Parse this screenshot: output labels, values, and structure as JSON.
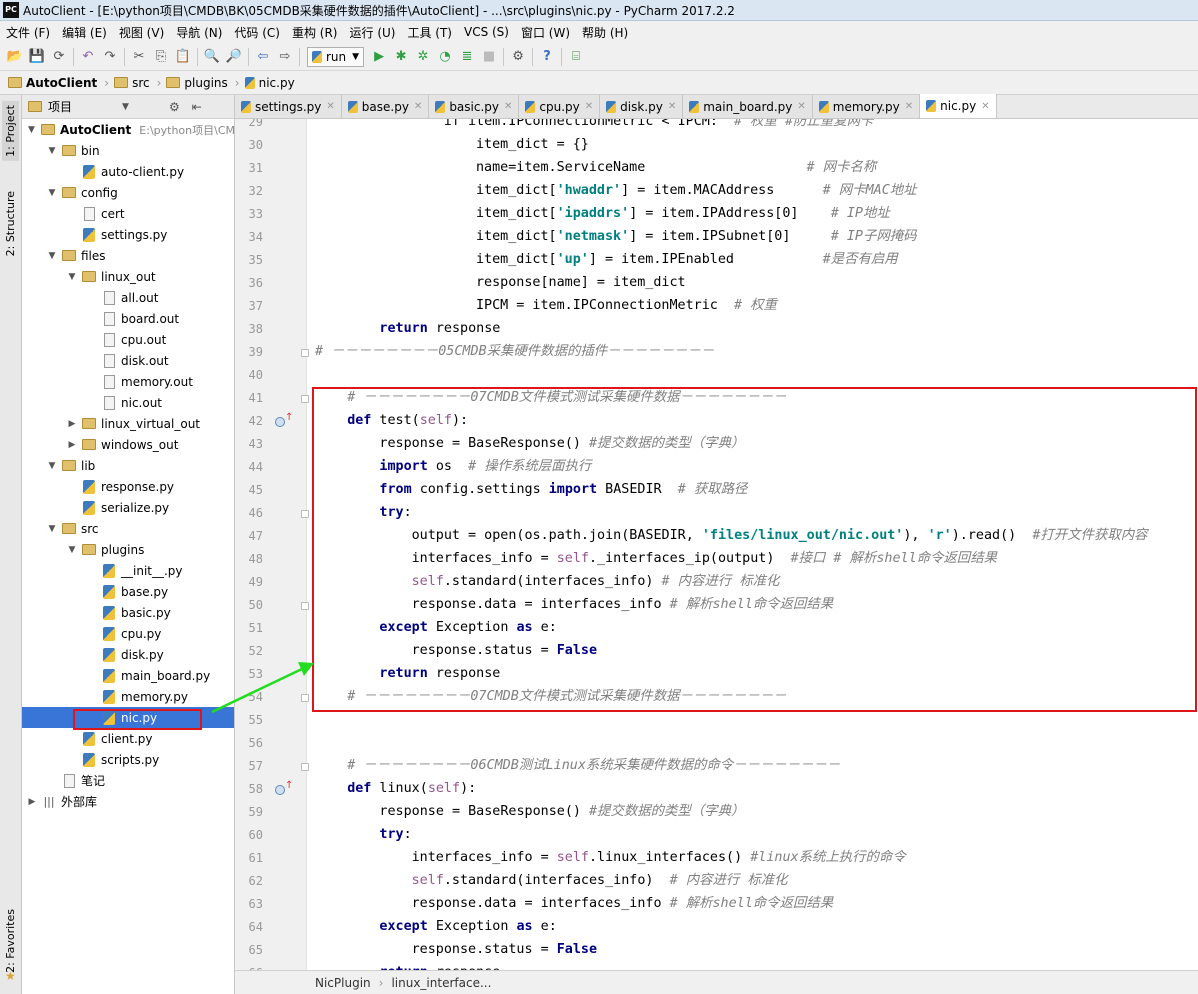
{
  "window": {
    "title": "AutoClient - [E:\\python项目\\CMDB\\BK\\05CMDB采集硬件数据的插件\\AutoClient] - ...\\src\\plugins\\nic.py - PyCharm 2017.2.2",
    "app_icon": "PC"
  },
  "menu": [
    "文件 (F)",
    "编辑 (E)",
    "视图 (V)",
    "导航 (N)",
    "代码 (C)",
    "重构 (R)",
    "运行 (U)",
    "工具 (T)",
    "VCS (S)",
    "窗口 (W)",
    "帮助 (H)"
  ],
  "toolbar": {
    "run_config": "run"
  },
  "breadcrumb": [
    "AutoClient",
    "src",
    "plugins",
    "nic.py"
  ],
  "left_tabs": {
    "project": "1: Project",
    "structure": "2: Structure",
    "favorites": "2: Favorites"
  },
  "project": {
    "header": "项目",
    "tree": [
      {
        "label": "AutoClient",
        "hint": "E:\\python项目\\CM",
        "type": "folder",
        "depth": 0,
        "expanded": true,
        "bold": true
      },
      {
        "label": "bin",
        "type": "folder",
        "depth": 1,
        "expanded": true
      },
      {
        "label": "auto-client.py",
        "type": "py",
        "depth": 2
      },
      {
        "label": "config",
        "type": "folder",
        "depth": 1,
        "expanded": true
      },
      {
        "label": "cert",
        "type": "file",
        "depth": 2
      },
      {
        "label": "settings.py",
        "type": "py",
        "depth": 2
      },
      {
        "label": "files",
        "type": "folder",
        "depth": 1,
        "expanded": true
      },
      {
        "label": "linux_out",
        "type": "folder",
        "depth": 2,
        "expanded": true
      },
      {
        "label": "all.out",
        "type": "file",
        "depth": 3
      },
      {
        "label": "board.out",
        "type": "file",
        "depth": 3
      },
      {
        "label": "cpu.out",
        "type": "file",
        "depth": 3
      },
      {
        "label": "disk.out",
        "type": "file",
        "depth": 3
      },
      {
        "label": "memory.out",
        "type": "file",
        "depth": 3
      },
      {
        "label": "nic.out",
        "type": "file",
        "depth": 3
      },
      {
        "label": "linux_virtual_out",
        "type": "folder",
        "depth": 2,
        "expanded": false
      },
      {
        "label": "windows_out",
        "type": "folder",
        "depth": 2,
        "expanded": false
      },
      {
        "label": "lib",
        "type": "folder",
        "depth": 1,
        "expanded": true
      },
      {
        "label": "response.py",
        "type": "py",
        "depth": 2
      },
      {
        "label": "serialize.py",
        "type": "py",
        "depth": 2
      },
      {
        "label": "src",
        "type": "folder",
        "depth": 1,
        "expanded": true
      },
      {
        "label": "plugins",
        "type": "folder",
        "depth": 2,
        "expanded": true
      },
      {
        "label": "__init__.py",
        "type": "py",
        "depth": 3
      },
      {
        "label": "base.py",
        "type": "py",
        "depth": 3
      },
      {
        "label": "basic.py",
        "type": "py",
        "depth": 3
      },
      {
        "label": "cpu.py",
        "type": "py",
        "depth": 3
      },
      {
        "label": "disk.py",
        "type": "py",
        "depth": 3
      },
      {
        "label": "main_board.py",
        "type": "py",
        "depth": 3
      },
      {
        "label": "memory.py",
        "type": "py",
        "depth": 3
      },
      {
        "label": "nic.py",
        "type": "py",
        "depth": 3,
        "selected": true
      },
      {
        "label": "client.py",
        "type": "py",
        "depth": 2
      },
      {
        "label": "scripts.py",
        "type": "py",
        "depth": 2
      },
      {
        "label": "笔记",
        "type": "file",
        "depth": 1
      },
      {
        "label": "外部库",
        "type": "lib",
        "depth": 0,
        "expanded": false
      }
    ]
  },
  "tabs": [
    {
      "label": "settings.py"
    },
    {
      "label": "base.py"
    },
    {
      "label": "basic.py"
    },
    {
      "label": "cpu.py"
    },
    {
      "label": "disk.py"
    },
    {
      "label": "main_board.py"
    },
    {
      "label": "memory.py"
    },
    {
      "label": "nic.py",
      "active": true
    }
  ],
  "code": [
    {
      "n": "29",
      "i": 16,
      "t": [
        [
          "if item.IPConnectionMetric < IPCM:  ",
          ""
        ],
        [
          "# 权重 #防止重复网卡",
          "c"
        ]
      ]
    },
    {
      "n": "30",
      "i": 20,
      "t": [
        [
          "item_dict = {}",
          ""
        ]
      ]
    },
    {
      "n": "31",
      "i": 20,
      "t": [
        [
          "name=item.ServiceName                    ",
          ""
        ],
        [
          "# 网卡名称",
          "c"
        ]
      ]
    },
    {
      "n": "32",
      "i": 20,
      "t": [
        [
          "item_dict[",
          ""
        ],
        [
          "'hwaddr'",
          "s"
        ],
        [
          "] = item.MACAddress      ",
          ""
        ],
        [
          "# 网卡MAC地址",
          "c"
        ]
      ]
    },
    {
      "n": "33",
      "i": 20,
      "t": [
        [
          "item_dict[",
          ""
        ],
        [
          "'ipaddrs'",
          "s"
        ],
        [
          "] = item.IPAddress[0]    ",
          ""
        ],
        [
          "# IP地址",
          "c"
        ]
      ]
    },
    {
      "n": "34",
      "i": 20,
      "t": [
        [
          "item_dict[",
          ""
        ],
        [
          "'netmask'",
          "s"
        ],
        [
          "] = item.IPSubnet[0]     ",
          ""
        ],
        [
          "# IP子网掩码",
          "c"
        ]
      ]
    },
    {
      "n": "35",
      "i": 20,
      "t": [
        [
          "item_dict[",
          ""
        ],
        [
          "'up'",
          "s"
        ],
        [
          "] = item.IPEnabled           ",
          ""
        ],
        [
          "#是否有启用",
          "c"
        ]
      ]
    },
    {
      "n": "36",
      "i": 20,
      "t": [
        [
          "response[name] = item_dict",
          ""
        ]
      ]
    },
    {
      "n": "37",
      "i": 20,
      "t": [
        [
          "IPCM = item.IPConnectionMetric  ",
          ""
        ],
        [
          "# 权重",
          "c"
        ]
      ]
    },
    {
      "n": "38",
      "i": 8,
      "t": [
        [
          "return",
          "k"
        ],
        [
          " response",
          ""
        ]
      ]
    },
    {
      "n": "39",
      "i": 0,
      "t": [
        [
          "# －－－－－－－－05CMDB采集硬件数据的插件－－－－－－－－",
          "c"
        ]
      ]
    },
    {
      "n": "40",
      "i": 0,
      "t": []
    },
    {
      "n": "41",
      "i": 4,
      "t": [
        [
          "# －－－－－－－－07CMDB文件模式测试采集硬件数据－－－－－－－－",
          "c"
        ]
      ]
    },
    {
      "n": "42",
      "i": 4,
      "t": [
        [
          "def",
          "k"
        ],
        [
          " test(",
          ""
        ],
        [
          "self",
          "sf"
        ],
        [
          "):",
          ""
        ]
      ]
    },
    {
      "n": "43",
      "i": 8,
      "t": [
        [
          "response = BaseResponse() ",
          ""
        ],
        [
          "#提交数据的类型（字典）",
          "c"
        ]
      ]
    },
    {
      "n": "44",
      "i": 8,
      "t": [
        [
          "import",
          "k"
        ],
        [
          " os  ",
          ""
        ],
        [
          "# 操作系统层面执行",
          "c"
        ]
      ]
    },
    {
      "n": "45",
      "i": 8,
      "t": [
        [
          "from",
          "k"
        ],
        [
          " config.settings ",
          ""
        ],
        [
          "import",
          "k"
        ],
        [
          " BASEDIR  ",
          ""
        ],
        [
          "# 获取路径",
          "c"
        ]
      ]
    },
    {
      "n": "46",
      "i": 8,
      "t": [
        [
          "try",
          "k"
        ],
        [
          ":",
          ""
        ]
      ]
    },
    {
      "n": "47",
      "i": 12,
      "t": [
        [
          "output = open(os.path.join(BASEDIR, ",
          ""
        ],
        [
          "'files/linux_out/nic.out'",
          "s"
        ],
        [
          "), ",
          ""
        ],
        [
          "'r'",
          "s"
        ],
        [
          ").read()  ",
          ""
        ],
        [
          "#打开文件获取内容",
          "c"
        ]
      ]
    },
    {
      "n": "48",
      "i": 12,
      "t": [
        [
          "interfaces_info = ",
          ""
        ],
        [
          "self",
          "sf"
        ],
        [
          "._interfaces_ip(output)  ",
          ""
        ],
        [
          "#接口 # 解析shell命令返回结果",
          "c"
        ]
      ]
    },
    {
      "n": "49",
      "i": 12,
      "t": [
        [
          "self",
          "sf"
        ],
        [
          ".standard(interfaces_info) ",
          ""
        ],
        [
          "# 内容进行 标准化",
          "c"
        ]
      ]
    },
    {
      "n": "50",
      "i": 12,
      "t": [
        [
          "response.data = interfaces_info ",
          ""
        ],
        [
          "# 解析shell命令返回结果",
          "c"
        ]
      ]
    },
    {
      "n": "51",
      "i": 8,
      "t": [
        [
          "except",
          "k"
        ],
        [
          " Exception ",
          ""
        ],
        [
          "as",
          "k"
        ],
        [
          " e:",
          ""
        ]
      ]
    },
    {
      "n": "52",
      "i": 12,
      "t": [
        [
          "response.status = ",
          ""
        ],
        [
          "False",
          "k"
        ]
      ]
    },
    {
      "n": "53",
      "i": 8,
      "t": [
        [
          "return",
          "k"
        ],
        [
          " response",
          ""
        ]
      ]
    },
    {
      "n": "54",
      "i": 4,
      "t": [
        [
          "# －－－－－－－－07CMDB文件模式测试采集硬件数据－－－－－－－－",
          "c"
        ]
      ]
    },
    {
      "n": "55",
      "i": 0,
      "t": []
    },
    {
      "n": "56",
      "i": 0,
      "t": []
    },
    {
      "n": "57",
      "i": 4,
      "t": [
        [
          "# －－－－－－－－06CMDB测试Linux系统采集硬件数据的命令－－－－－－－－",
          "c"
        ]
      ]
    },
    {
      "n": "58",
      "i": 4,
      "t": [
        [
          "def",
          "k"
        ],
        [
          " linux(",
          ""
        ],
        [
          "self",
          "sf"
        ],
        [
          "):",
          ""
        ]
      ]
    },
    {
      "n": "59",
      "i": 8,
      "t": [
        [
          "response = BaseResponse() ",
          ""
        ],
        [
          "#提交数据的类型（字典）",
          "c"
        ]
      ]
    },
    {
      "n": "60",
      "i": 8,
      "t": [
        [
          "try",
          "k"
        ],
        [
          ":",
          ""
        ]
      ]
    },
    {
      "n": "61",
      "i": 12,
      "t": [
        [
          "interfaces_info = ",
          ""
        ],
        [
          "self",
          "sf"
        ],
        [
          ".linux_interfaces() ",
          ""
        ],
        [
          "#linux系统上执行的命令",
          "c"
        ]
      ]
    },
    {
      "n": "62",
      "i": 12,
      "t": [
        [
          "self",
          "sf"
        ],
        [
          ".standard(interfaces_info)  ",
          ""
        ],
        [
          "# 内容进行 标准化",
          "c"
        ]
      ]
    },
    {
      "n": "63",
      "i": 12,
      "t": [
        [
          "response.data = interfaces_info ",
          ""
        ],
        [
          "# 解析shell命令返回结果",
          "c"
        ]
      ]
    },
    {
      "n": "64",
      "i": 8,
      "t": [
        [
          "except",
          "k"
        ],
        [
          " Exception ",
          ""
        ],
        [
          "as",
          "k"
        ],
        [
          " e:",
          ""
        ]
      ]
    },
    {
      "n": "65",
      "i": 12,
      "t": [
        [
          "response.status = ",
          ""
        ],
        [
          "False",
          "k"
        ]
      ]
    },
    {
      "n": "66",
      "i": 8,
      "t": [
        [
          "return",
          "k"
        ],
        [
          " response",
          ""
        ]
      ]
    }
  ],
  "status": {
    "class": "NicPlugin",
    "method": "linux_interface..."
  },
  "colors": {
    "keyword": "#000080",
    "string": "#008080",
    "comment": "#808080",
    "self": "#94558d",
    "highlight": "#e0151a",
    "arrow": "#22dd22",
    "selection": "#3875d7"
  }
}
